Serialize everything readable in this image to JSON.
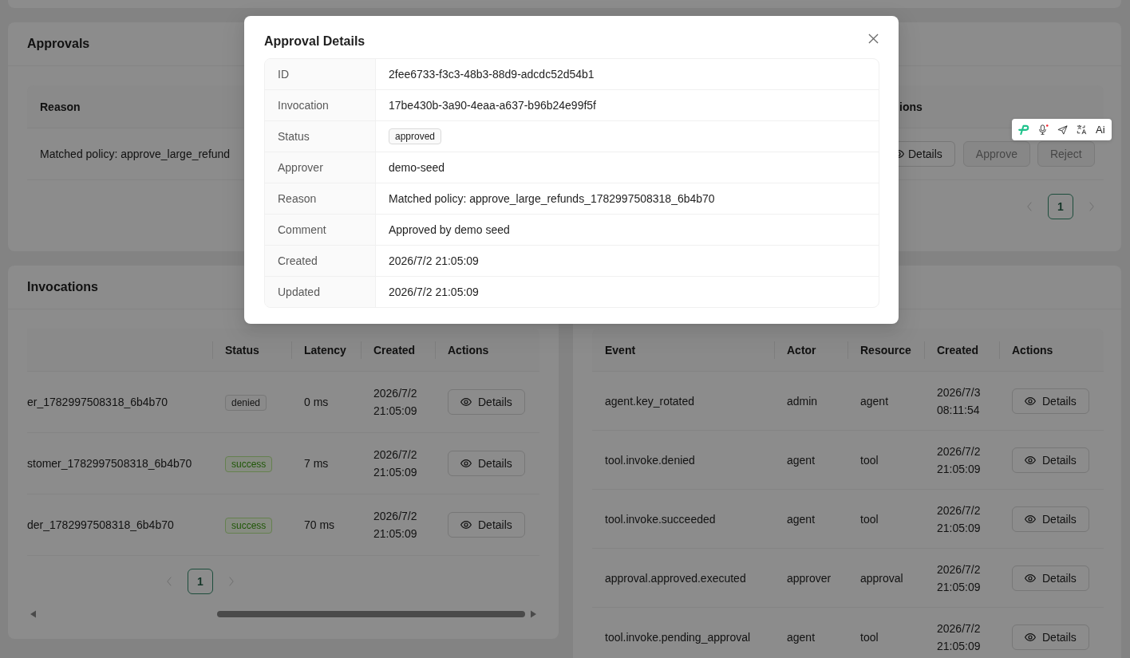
{
  "approvals": {
    "title": "Approvals",
    "table": {
      "columns": [
        "Reason",
        "ions"
      ],
      "rows": [
        {
          "reason": "Matched policy: approve_large_refund",
          "actions": [
            {
              "label": "Details",
              "kind": "details",
              "disabled": false
            },
            {
              "label": "Approve",
              "kind": "approve",
              "disabled": true
            },
            {
              "label": "Reject",
              "kind": "reject",
              "disabled": true
            }
          ]
        }
      ]
    },
    "pagination": {
      "prev_disabled": true,
      "pages": [
        {
          "label": "1",
          "selected": true
        }
      ],
      "next_disabled": true
    }
  },
  "invocations": {
    "title": "Invocations",
    "table": {
      "columns": [
        "Status",
        "Latency",
        "Created",
        "Actions"
      ],
      "rows": [
        {
          "column_1": "er_1782997508318_6b4b70",
          "status": {
            "label": "denied",
            "kind": "default"
          },
          "latency": "0 ms",
          "created": "2026/7/2 21:05:09",
          "action": "Details"
        },
        {
          "column_1": "stomer_1782997508318_6b4b70",
          "status": {
            "label": "success",
            "kind": "success"
          },
          "latency": "7 ms",
          "created": "2026/7/2 21:05:09",
          "action": "Details"
        },
        {
          "column_1": "der_1782997508318_6b4b70",
          "status": {
            "label": "success",
            "kind": "success"
          },
          "latency": "70 ms",
          "created": "2026/7/2 21:05:09",
          "action": "Details"
        }
      ]
    },
    "pagination": {
      "prev_disabled": true,
      "pages": [
        {
          "label": "1",
          "selected": true
        }
      ],
      "next_disabled": true
    }
  },
  "events_panel": {
    "table": {
      "columns": [
        "Event",
        "Actor",
        "Resource",
        "Created",
        "Actions"
      ],
      "rows": [
        {
          "event": "agent.key_rotated",
          "actor": "admin",
          "resource": "agent",
          "created": "2026/7/3 08:11:54",
          "action": "Details"
        },
        {
          "event": "tool.invoke.denied",
          "actor": "agent",
          "resource": "tool",
          "created": "2026/7/2 21:05:09",
          "action": "Details"
        },
        {
          "event": "tool.invoke.succeeded",
          "actor": "agent",
          "resource": "tool",
          "created": "2026/7/2 21:05:09",
          "action": "Details"
        },
        {
          "event": "approval.approved.executed",
          "actor": "approver",
          "resource": "approval",
          "created": "2026/7/2 21:05:09",
          "action": "Details"
        },
        {
          "event": "tool.invoke.pending_approval",
          "actor": "agent",
          "resource": "tool",
          "created": "2026/7/2 21:05:09",
          "action": "Details"
        }
      ]
    }
  },
  "modal": {
    "title": "Approval Details",
    "fields": [
      {
        "label": "ID",
        "value": "2fee6733-f3c3-48b3-88d9-adcdc52d54b1",
        "kind": "text"
      },
      {
        "label": "Invocation",
        "value": "17be430b-3a90-4eaa-a637-b96b24e99f5f",
        "kind": "text"
      },
      {
        "label": "Status",
        "value": "approved",
        "kind": "tag"
      },
      {
        "label": "Approver",
        "value": "demo-seed",
        "kind": "text"
      },
      {
        "label": "Reason",
        "value": "Matched policy: approve_large_refunds_1782997508318_6b4b70",
        "kind": "text"
      },
      {
        "label": "Comment",
        "value": "Approved by demo seed",
        "kind": "text"
      },
      {
        "label": "Created",
        "value": "2026/7/2 21:05:09",
        "kind": "text"
      },
      {
        "label": "Updated",
        "value": "2026/7/2 21:05:09",
        "kind": "text"
      }
    ]
  },
  "floating_toolbar": {
    "ai_label": "Ai"
  }
}
